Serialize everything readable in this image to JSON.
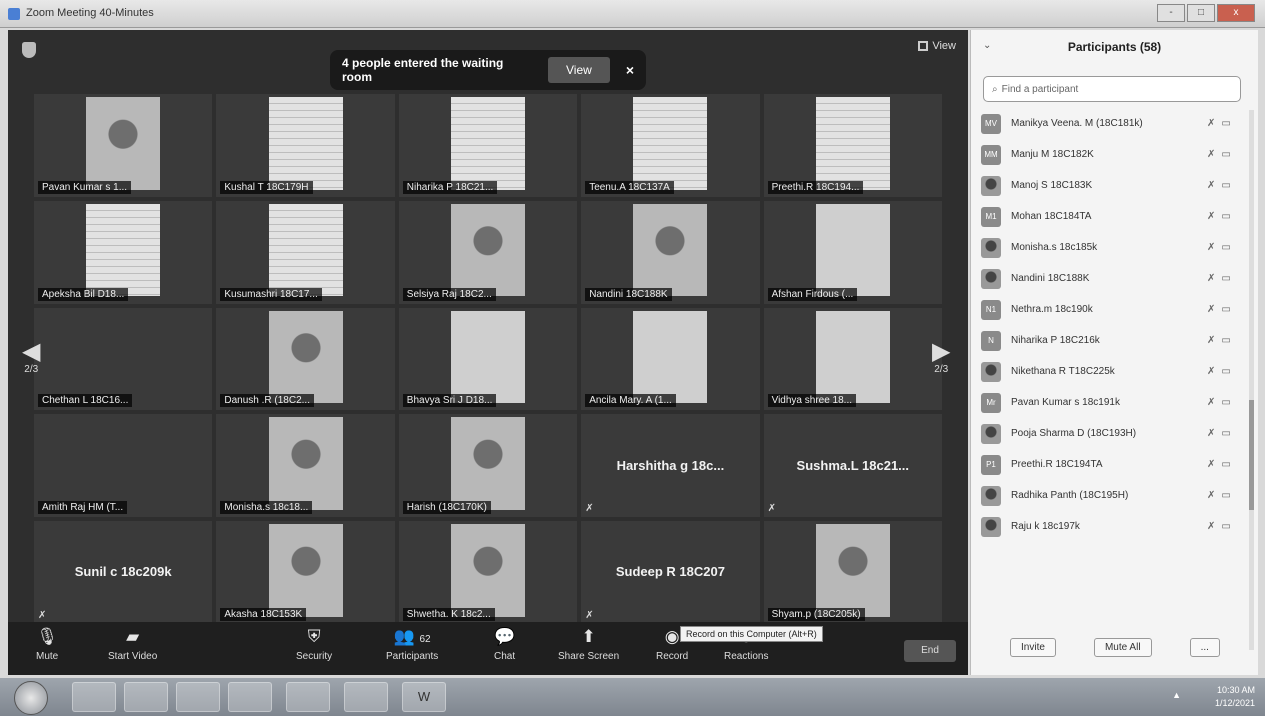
{
  "window": {
    "title": "Zoom Meeting 40-Minutes",
    "min": "-",
    "max": "□",
    "close": "x"
  },
  "meeting": {
    "view_label": "View",
    "notice": {
      "text": "4 people entered the waiting room",
      "view": "View",
      "close": "×"
    },
    "page_left": "2/3",
    "page_right": "2/3",
    "tiles": [
      {
        "label": "Pavan Kumar s 1...",
        "kind": "face"
      },
      {
        "label": "Kushal T 18C179H",
        "kind": "paper"
      },
      {
        "label": "Niharika P 18C21...",
        "kind": "paper"
      },
      {
        "label": "Teenu.A 18C137A",
        "kind": "paper"
      },
      {
        "label": "Preethi.R 18C194...",
        "kind": "paper"
      },
      {
        "label": "Apeksha Bil D18...",
        "kind": "paper"
      },
      {
        "label": "Kusumashri 18C17...",
        "kind": "paper"
      },
      {
        "label": "Selsiya Raj 18C2...",
        "kind": "face"
      },
      {
        "label": "Nandini 18C188K",
        "kind": "face"
      },
      {
        "label": "Afshan Firdous (...",
        "kind": "plain"
      },
      {
        "label": "Chethan L 18C16...",
        "kind": "none"
      },
      {
        "label": "Danush .R (18C2...",
        "kind": "face"
      },
      {
        "label": "Bhavya Sri J D18...",
        "kind": "plain"
      },
      {
        "label": "Ancila Mary. A (1...",
        "kind": "plain"
      },
      {
        "label": "Vidhya shree 18...",
        "kind": "plain"
      },
      {
        "label": "Amith Raj HM (T...",
        "kind": "none"
      },
      {
        "label": "Monisha.s 18c18...",
        "kind": "face"
      },
      {
        "label": "Harish (18C170K)",
        "kind": "face"
      },
      {
        "name": "Harshitha g 18c...",
        "kind": "name"
      },
      {
        "name": "Sushma.L 18c21...",
        "kind": "name"
      },
      {
        "name": "Sunil c 18c209k",
        "kind": "name"
      },
      {
        "label": "Akasha 18C153K",
        "kind": "face"
      },
      {
        "label": "Shwetha. K 18c2...",
        "kind": "face"
      },
      {
        "name": "Sudeep R 18C207",
        "kind": "name"
      },
      {
        "label": "Shyam.p (18C205k)",
        "kind": "face"
      }
    ]
  },
  "toolbar": {
    "mute": "Mute",
    "start_video": "Start Video",
    "security": "Security",
    "participants": "Participants",
    "participants_count": "62",
    "chat": "Chat",
    "share_screen": "Share Screen",
    "record": "Record",
    "reactions": "Reactions",
    "record_tooltip": "Record on this Computer (Alt+R)",
    "end": "End"
  },
  "panel": {
    "title": "Participants (58)",
    "search_placeholder": "Find a participant",
    "participants": [
      {
        "initials": "MV",
        "name": "Manikya Veena. M (18C181k)",
        "photo": false
      },
      {
        "initials": "MM",
        "name": "Manju M 18C182K",
        "photo": false
      },
      {
        "initials": "",
        "name": "Manoj S 18C183K",
        "photo": true
      },
      {
        "initials": "M1",
        "name": "Mohan 18C184TA",
        "photo": false
      },
      {
        "initials": "",
        "name": "Monisha.s 18c185k",
        "photo": true
      },
      {
        "initials": "",
        "name": "Nandini 18C188K",
        "photo": true
      },
      {
        "initials": "N1",
        "name": "Nethra.m 18c190k",
        "photo": false
      },
      {
        "initials": "N",
        "name": "Niharika P 18C216k",
        "photo": false
      },
      {
        "initials": "",
        "name": "Nikethana R T18C225k",
        "photo": true
      },
      {
        "initials": "Mr",
        "name": "Pavan Kumar s 18c191k",
        "photo": false
      },
      {
        "initials": "",
        "name": "Pooja Sharma D (18C193H)",
        "photo": true
      },
      {
        "initials": "P1",
        "name": "Preethi.R 18C194TA",
        "photo": false
      },
      {
        "initials": "",
        "name": "Radhika Panth (18C195H)",
        "photo": true
      },
      {
        "initials": "",
        "name": "Raju k 18c197k",
        "photo": true
      }
    ],
    "invite": "Invite",
    "mute_all": "Mute All",
    "more": "..."
  },
  "taskbar": {
    "items": [
      "",
      "",
      "",
      "",
      "",
      "",
      "W"
    ],
    "time": "10:30 AM",
    "date": "1/12/2021"
  }
}
